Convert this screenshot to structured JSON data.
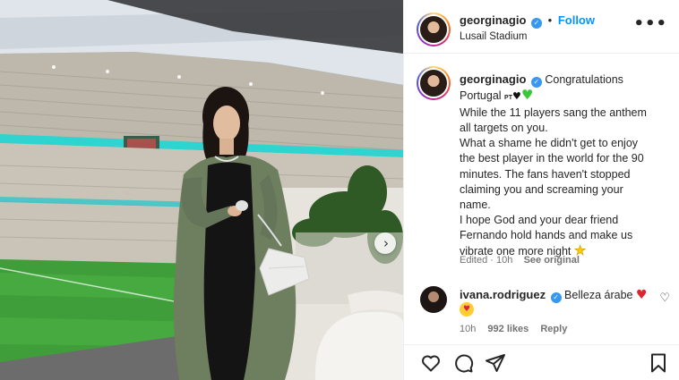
{
  "post": {
    "username": "georginagio",
    "follow_label": "Follow",
    "location": "Lusail Stadium",
    "more_label": "•••"
  },
  "caption": {
    "username": "georginagio",
    "line1": "Congratulations",
    "line2_text": "Portugal",
    "line2_flag": "PT",
    "line2_heart_black": "♥",
    "line2_heart_green": "♥",
    "lines": [
      "While the 11 players sang the anthem",
      "all targets on you.",
      "What a shame he didn't get to enjoy",
      "the best player in the world for the 90",
      "minutes. The fans haven't stopped",
      "claiming you and screaming your",
      "name.",
      "I hope God and your dear friend",
      "Fernando hold hands and make us"
    ],
    "last_line": "vibrate one more night",
    "last_emoji": "★",
    "edited": "Edited · 10h",
    "see_original": "See original"
  },
  "comment": {
    "username": "ivana.rodriguez",
    "text": "Belleza árabe",
    "heart": "♥",
    "emoji": "♥",
    "time": "10h",
    "likes": "992 likes",
    "reply": "Reply",
    "like_icon": "♡"
  },
  "icons": {
    "verified": "✓",
    "next": "›"
  },
  "colors": {
    "accent_blue": "#0095f6",
    "verified_blue": "#3897f0",
    "heart_red": "#e0252d",
    "heart_green": "#3ac73a",
    "dress_green": "#6e7f5f"
  }
}
